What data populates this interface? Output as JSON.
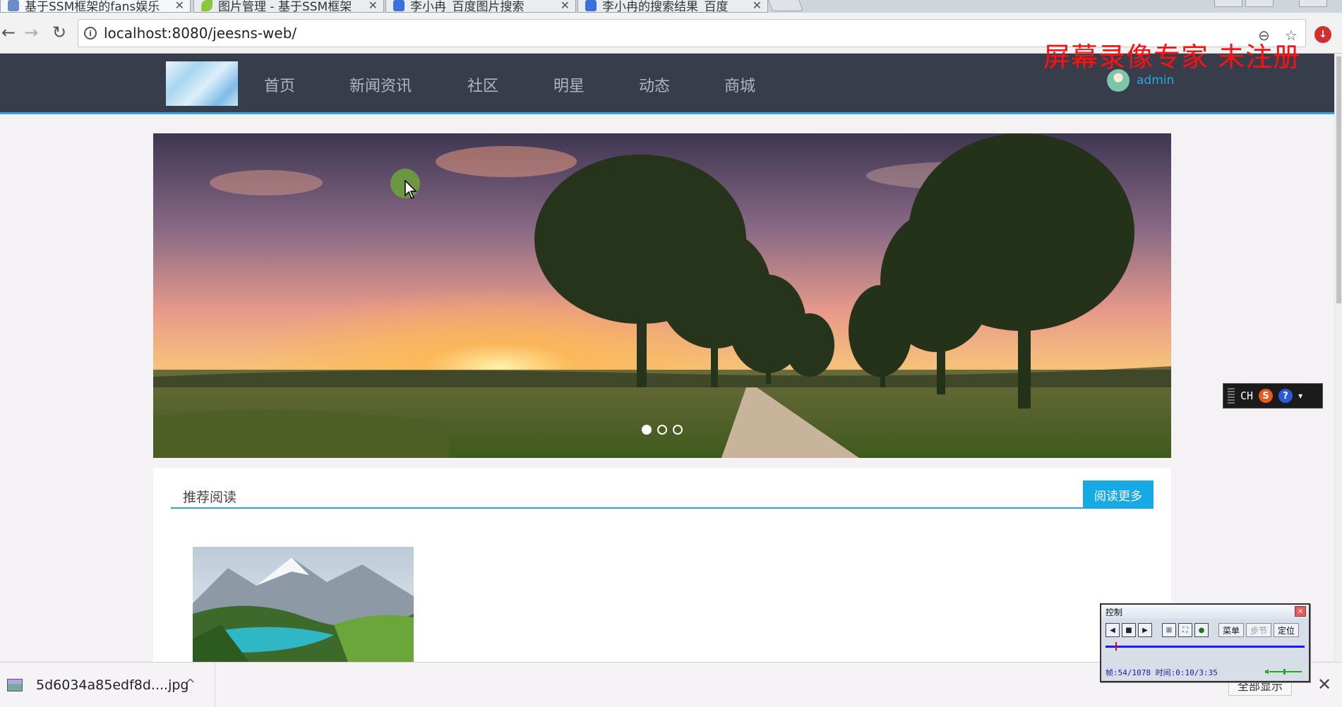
{
  "browser": {
    "tabs": [
      {
        "title": "基于SSM框架的fans娱乐",
        "active": true,
        "favicon_color": "#6a8cc8"
      },
      {
        "title": "图片管理 - 基于SSM框架",
        "active": false,
        "favicon_color": "#8cc63e"
      },
      {
        "title": "李小冉_百度图片搜索",
        "active": false,
        "favicon_color": "#3d6fd8"
      },
      {
        "title": "李小冉的搜索结果_百度",
        "active": false,
        "favicon_color": "#3d6fd8"
      }
    ],
    "tab_close": "✕",
    "address": "localhost:8080/jeesns-web/",
    "info_glyph": "i",
    "back_glyph": "←",
    "forward_glyph": "→",
    "reload_glyph": "↻",
    "zoom_glyph": "⊖",
    "star_glyph": "☆",
    "extension_glyph": "↓"
  },
  "watermark": "屏幕录像专家  未注册",
  "site": {
    "nav": [
      "首页",
      "新闻资讯",
      "社区",
      "明星",
      "动态",
      "商城"
    ],
    "user": {
      "name": "admin"
    },
    "accent": "#2ba6e0",
    "header_bg": "#373d4b"
  },
  "carousel": {
    "slides": 3,
    "active_index": 0
  },
  "recommend": {
    "title": "推荐阅读",
    "read_more": "阅读更多"
  },
  "downloads": {
    "file_name": "5d6034a85edf8d....jpg",
    "chevron": "^",
    "show_all": "全部显示",
    "close": "✕"
  },
  "ime": {
    "lang": "CH",
    "logo": "S",
    "help": "?",
    "menu": "▾"
  },
  "recorder": {
    "title": "控制",
    "close": "×",
    "menu_label": "菜单",
    "step_label": "步节",
    "locate_label": "定位",
    "status": "帧:54/1078 时间:0:10/3:35",
    "progress_fraction": 0.05
  }
}
